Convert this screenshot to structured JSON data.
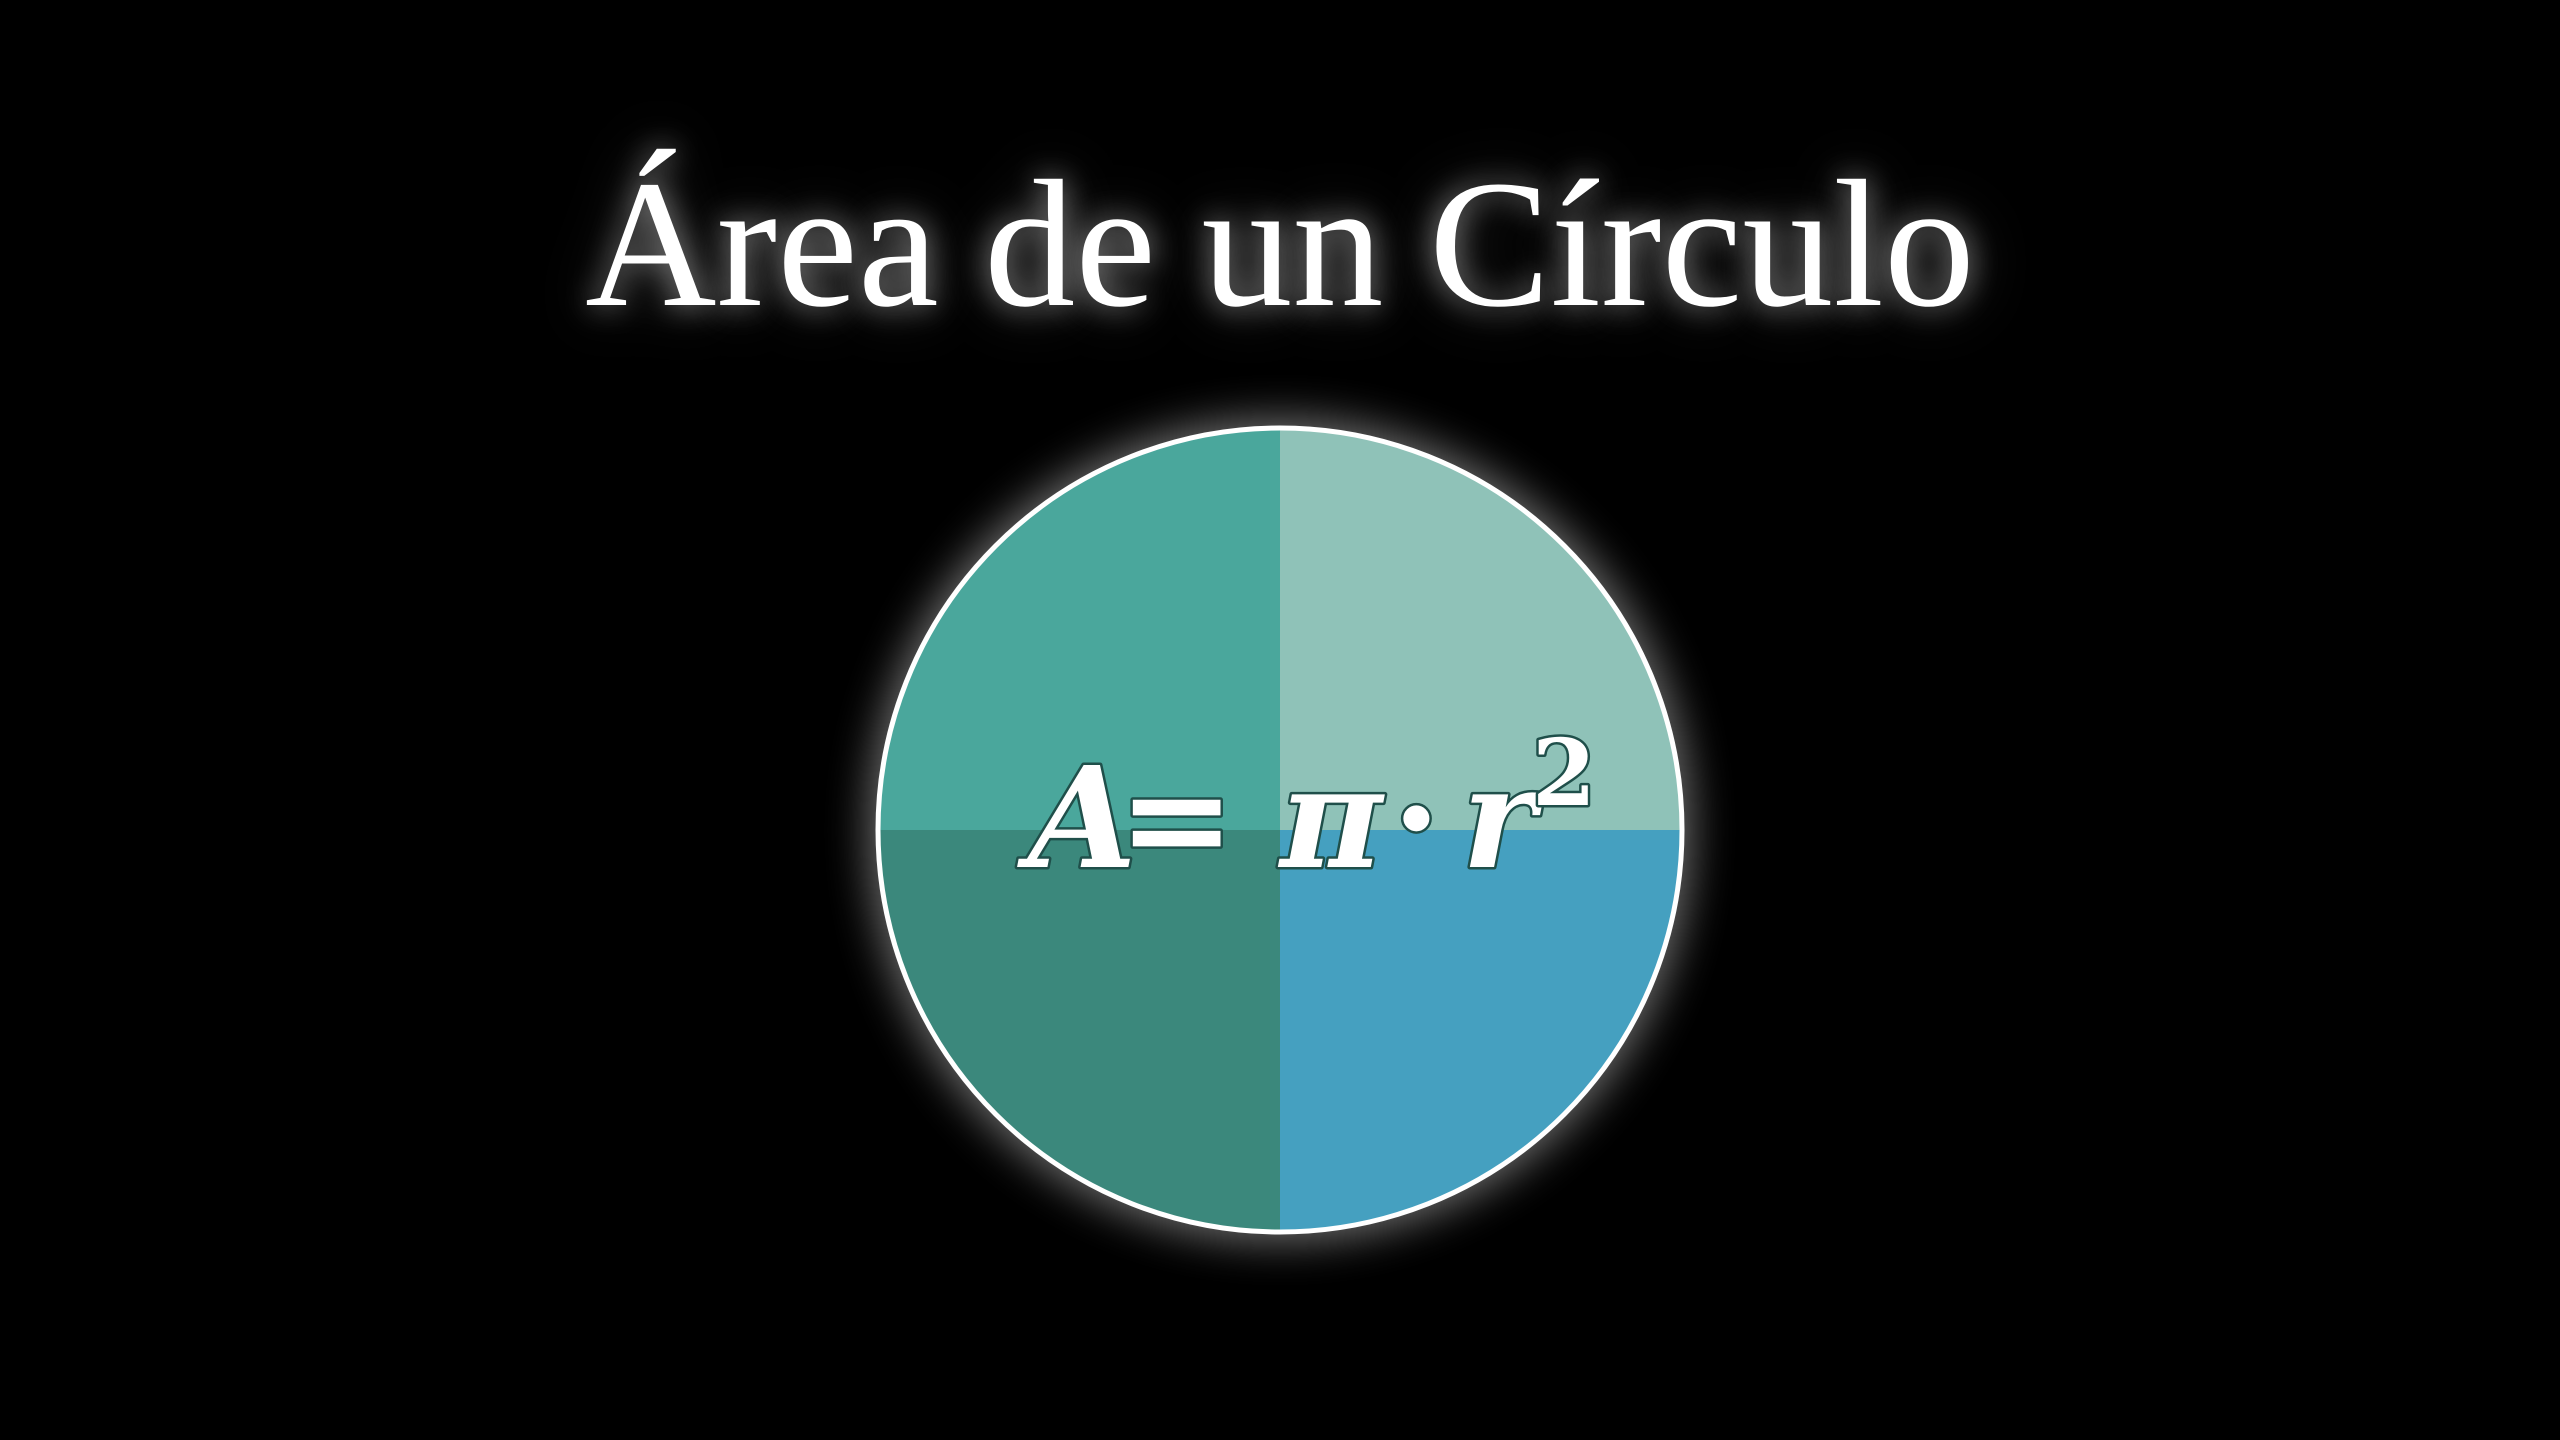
{
  "title": "Área de un Círculo",
  "formula": {
    "lhs": "A",
    "equals": "=",
    "pi": "π",
    "dot": "·",
    "r": "r",
    "exponent": "2"
  },
  "quadrants": [
    {
      "name": "top-left",
      "color": "#4aa79c"
    },
    {
      "name": "top-right",
      "color": "#8fc2b8"
    },
    {
      "name": "bottom-left",
      "color": "#3b887c"
    },
    {
      "name": "bottom-right",
      "color": "#45a0c0"
    }
  ],
  "colors": {
    "background": "#000000",
    "outline": "#ffffff",
    "text": "#ffffff",
    "formula_stroke": "#1f4f4a"
  }
}
